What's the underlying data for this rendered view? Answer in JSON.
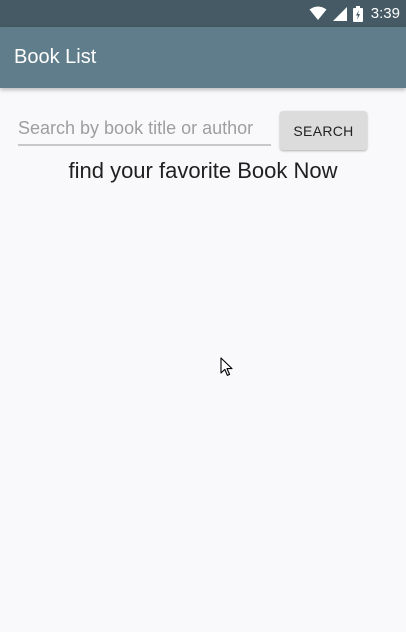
{
  "status_bar": {
    "time": "3:39",
    "icons": [
      "wifi-icon",
      "signal-icon",
      "battery-icon"
    ]
  },
  "app_bar": {
    "title": "Book List",
    "color": "#607d8b"
  },
  "search": {
    "placeholder": "Search by book title or author",
    "value": "",
    "button_label": "SEARCH"
  },
  "main": {
    "tagline": "find your favorite Book Now"
  },
  "colors": {
    "status_bar": "#455a64",
    "background": "#f9f9fb",
    "button": "#dcdcdc"
  }
}
